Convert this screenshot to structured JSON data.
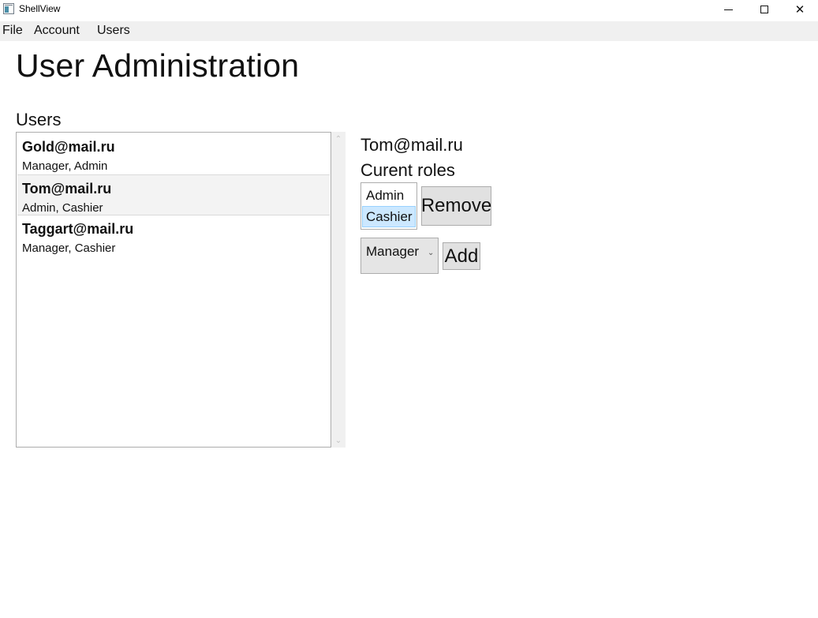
{
  "window": {
    "title": "ShellView",
    "minimize_glyph": "—",
    "maximize_glyph": "☐",
    "close_glyph": "✕"
  },
  "menu": {
    "items": [
      {
        "label": "File"
      },
      {
        "label": "Account"
      },
      {
        "label": "Users"
      }
    ]
  },
  "page": {
    "title": "User Administration",
    "users_label": "Users"
  },
  "users": [
    {
      "email": "Gold@mail.ru",
      "roles": "Manager, Admin",
      "selected": false
    },
    {
      "email": "Tom@mail.ru",
      "roles": "Admin, Cashier",
      "selected": true
    },
    {
      "email": "Taggart@mail.ru",
      "roles": "Manager, Cashier",
      "selected": false
    }
  ],
  "details": {
    "selected_email": "Tom@mail.ru",
    "roles_label": "Curent roles",
    "current_roles": [
      {
        "name": "Admin",
        "selected": false
      },
      {
        "name": "Cashier",
        "selected": true
      }
    ],
    "remove_label": "Remove",
    "role_combo": {
      "selected": "Manager",
      "arrow_icon": "chevron-down-icon"
    },
    "add_label": "Add"
  },
  "colors": {
    "selection_fill": "#cce8ff",
    "selection_border": "#99d1ff",
    "button_fill": "#e1e1e1",
    "menubar_fill": "#f0f0f0"
  }
}
